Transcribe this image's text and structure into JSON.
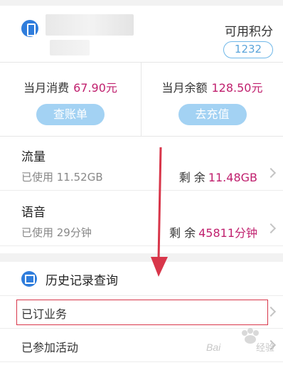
{
  "account": {
    "points_label": "可用积分",
    "points_value": "1232"
  },
  "summary": {
    "spend_label": "当月消费",
    "spend_amount": "67.90元",
    "bill_button": "查账单",
    "balance_label": "当月余额",
    "balance_amount": "128.50元",
    "recharge_button": "去充值"
  },
  "usage": [
    {
      "title": "流量",
      "used": "已使用 11.52GB",
      "remain_label": "剩 余",
      "remain_value": "11.48GB"
    },
    {
      "title": "语音",
      "used": "已使用 29分钟",
      "remain_label": "剩 余",
      "remain_value": "45811分钟"
    }
  ],
  "history": {
    "title": "历史记录查询",
    "items": [
      {
        "label": "已订业务"
      },
      {
        "label": "已参加活动"
      }
    ]
  },
  "colors": {
    "accent_blue": "#2f7ddc",
    "amount_magenta": "#c0206e",
    "button_light_blue": "#a3d2f3",
    "annotation_red": "#d8364a"
  },
  "watermark": "Baidu经验"
}
